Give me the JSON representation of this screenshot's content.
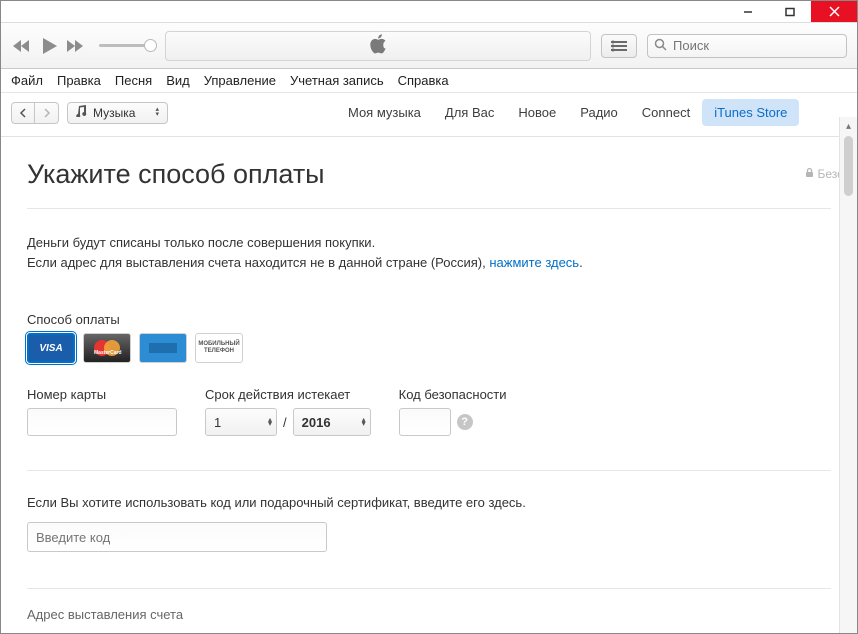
{
  "window": {
    "minimize": "—",
    "maximize": "▢",
    "close": "✕"
  },
  "toolbar": {
    "search_placeholder": "Поиск"
  },
  "menubar": [
    "Файл",
    "Правка",
    "Песня",
    "Вид",
    "Управление",
    "Учетная запись",
    "Справка"
  ],
  "library_selector": {
    "label": "Музыка"
  },
  "store_tabs": [
    "Моя музыка",
    "Для Вас",
    "Новое",
    "Радио",
    "Connect",
    "iTunes Store"
  ],
  "page": {
    "title": "Укажите способ оплаты",
    "secure": "Безопа",
    "intro_line1": "Деньги будут списаны только после совершения покупки.",
    "intro_line2_prefix": "Если адрес для выставления счета находится не в данной стране (Россия), ",
    "intro_link": "нажмите здесь",
    "intro_line2_suffix": "."
  },
  "payment": {
    "method_label": "Способ оплаты",
    "cards": {
      "visa": "VISA",
      "mastercard": "MasterCard",
      "amex": "AMEX",
      "mobile": "МОБИЛЬНЫЙ ТЕЛЕФОН"
    },
    "card_number_label": "Номер карты",
    "expiry_label": "Срок действия истекает",
    "security_label": "Код безопасности",
    "month": "1",
    "year": "2016",
    "slash": "/"
  },
  "gift": {
    "text": "Если Вы хотите использовать код или подарочный сертификат, введите его здесь.",
    "placeholder": "Введите код"
  },
  "billing": {
    "heading": "Адрес выставления счета"
  }
}
